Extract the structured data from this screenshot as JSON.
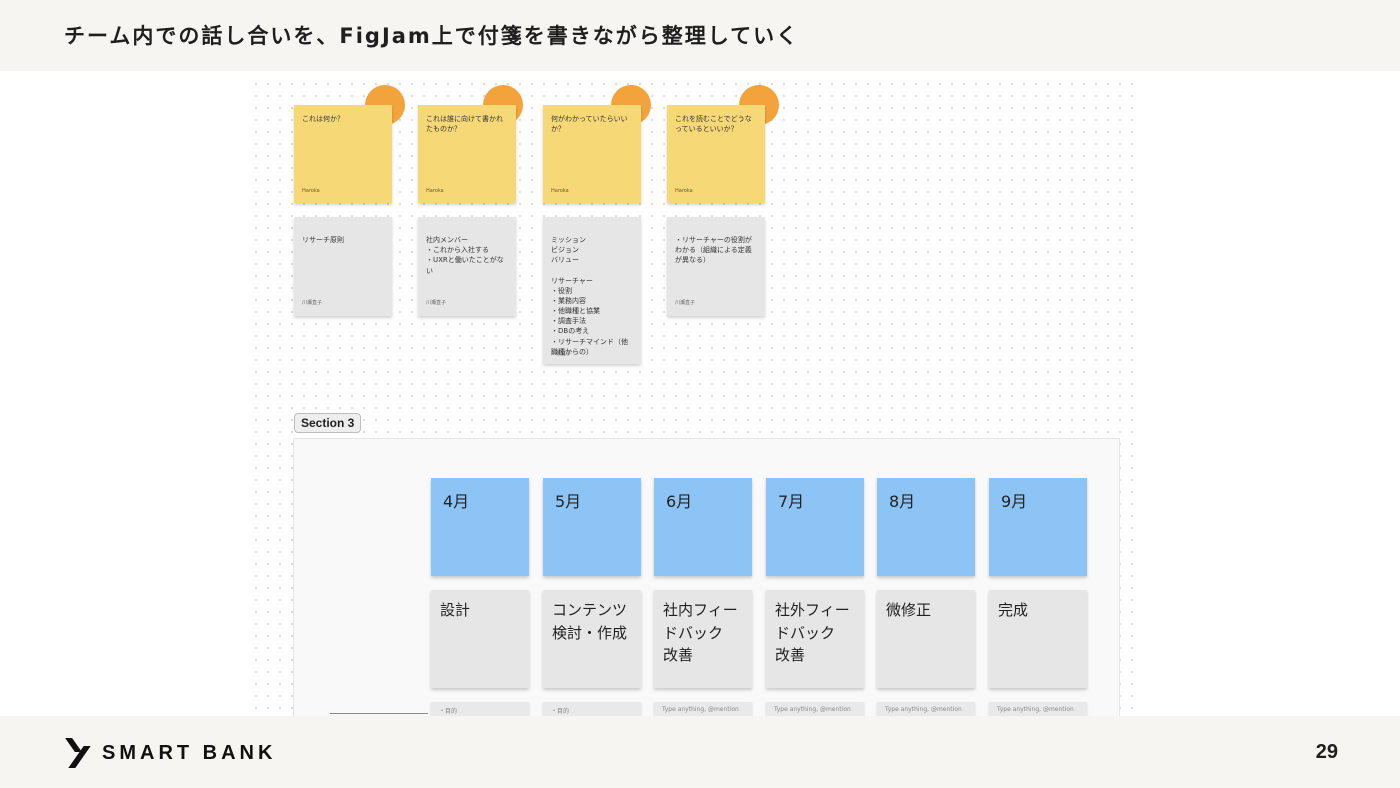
{
  "header": {
    "title": "チーム内での話し合いを、FigJam上で付箋を書きながら整理していく"
  },
  "questions": [
    {
      "question": "これは何か？",
      "author": "Haroka",
      "answer": "リサーチ原則",
      "answer_author": "川瀬直子"
    },
    {
      "question": "これは誰に向けて書かれたものか？",
      "author": "Haroka",
      "answer": "社内メンバー\n・これから入社する\n・UXRと働いたことがない",
      "answer_author": "川瀬直子"
    },
    {
      "question": "何がわかっていたらいいか？",
      "author": "Haroka",
      "answer": "ミッション\nビジョン\nバリュー\n\nリサーチャー\n・役割\n・業務内容\n・他職種と協業\n・調査手法\n・DBの考え\n・リサーチマインド（他職種からの）",
      "answer_author": "川瀬直子"
    },
    {
      "question": "これを読むことでどうなっているといいか？",
      "author": "Haroka",
      "answer": "・リサーチャーの役割がわかる（組織による定義が異なる）",
      "answer_author": "川瀬直子"
    }
  ],
  "section": {
    "label": "Section 3",
    "months": [
      "4月",
      "5月",
      "6月",
      "7月",
      "8月",
      "9月"
    ],
    "tasks": [
      "設計",
      "コンテンツ\n検討・作成",
      "社内フィー\nドバック\n改善",
      "社外フィー\nドバック\n改善",
      "微修正",
      "完成"
    ],
    "stubs": [
      "・目的",
      "・目的",
      "Type anything, @mention",
      "Type anything, @mention",
      "Type anything, @mention",
      "Type anything, @mention"
    ]
  },
  "footer": {
    "logo": "SMART BANK",
    "page_number": "29"
  },
  "colors": {
    "sticky_yellow": "#f7d877",
    "sticky_blue": "#8dc4f6",
    "sticky_grey": "#e6e6e6",
    "avatar_dot": "#f2a33c"
  }
}
